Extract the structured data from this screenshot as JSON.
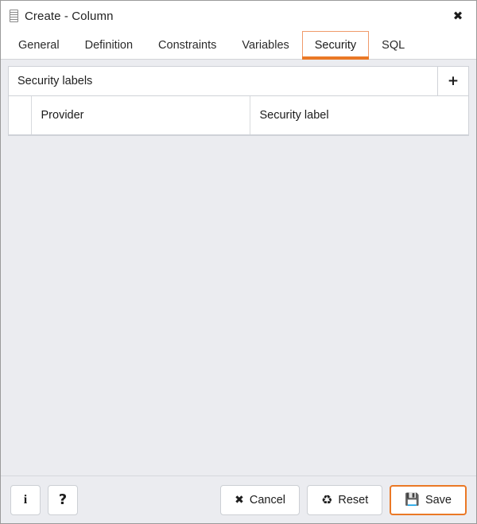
{
  "window": {
    "title": "Create - Column",
    "title_icon": "column-icon",
    "close_icon": "✖"
  },
  "tabs": [
    {
      "label": "General",
      "active": false
    },
    {
      "label": "Definition",
      "active": false
    },
    {
      "label": "Constraints",
      "active": false
    },
    {
      "label": "Variables",
      "active": false
    },
    {
      "label": "Security",
      "active": true
    },
    {
      "label": "SQL",
      "active": false
    }
  ],
  "panel": {
    "title": "Security labels",
    "add_icon": "➕",
    "add_label": "+",
    "columns": [
      "",
      "Provider",
      "Security label"
    ],
    "rows": []
  },
  "footer": {
    "info_label": "i",
    "help_label": "?",
    "cancel_label": "Cancel",
    "cancel_icon": "✖",
    "reset_label": "Reset",
    "reset_icon": "♻",
    "save_label": "Save",
    "save_icon": "💾"
  },
  "colors": {
    "accent": "#ea7826",
    "accent_light": "#f09a6a",
    "body_bg": "#ebecf0",
    "panel_bg": "#ffffff",
    "border": "#cfd2d8",
    "text": "#1e1e1e",
    "window_border": "#9a9a9a"
  }
}
